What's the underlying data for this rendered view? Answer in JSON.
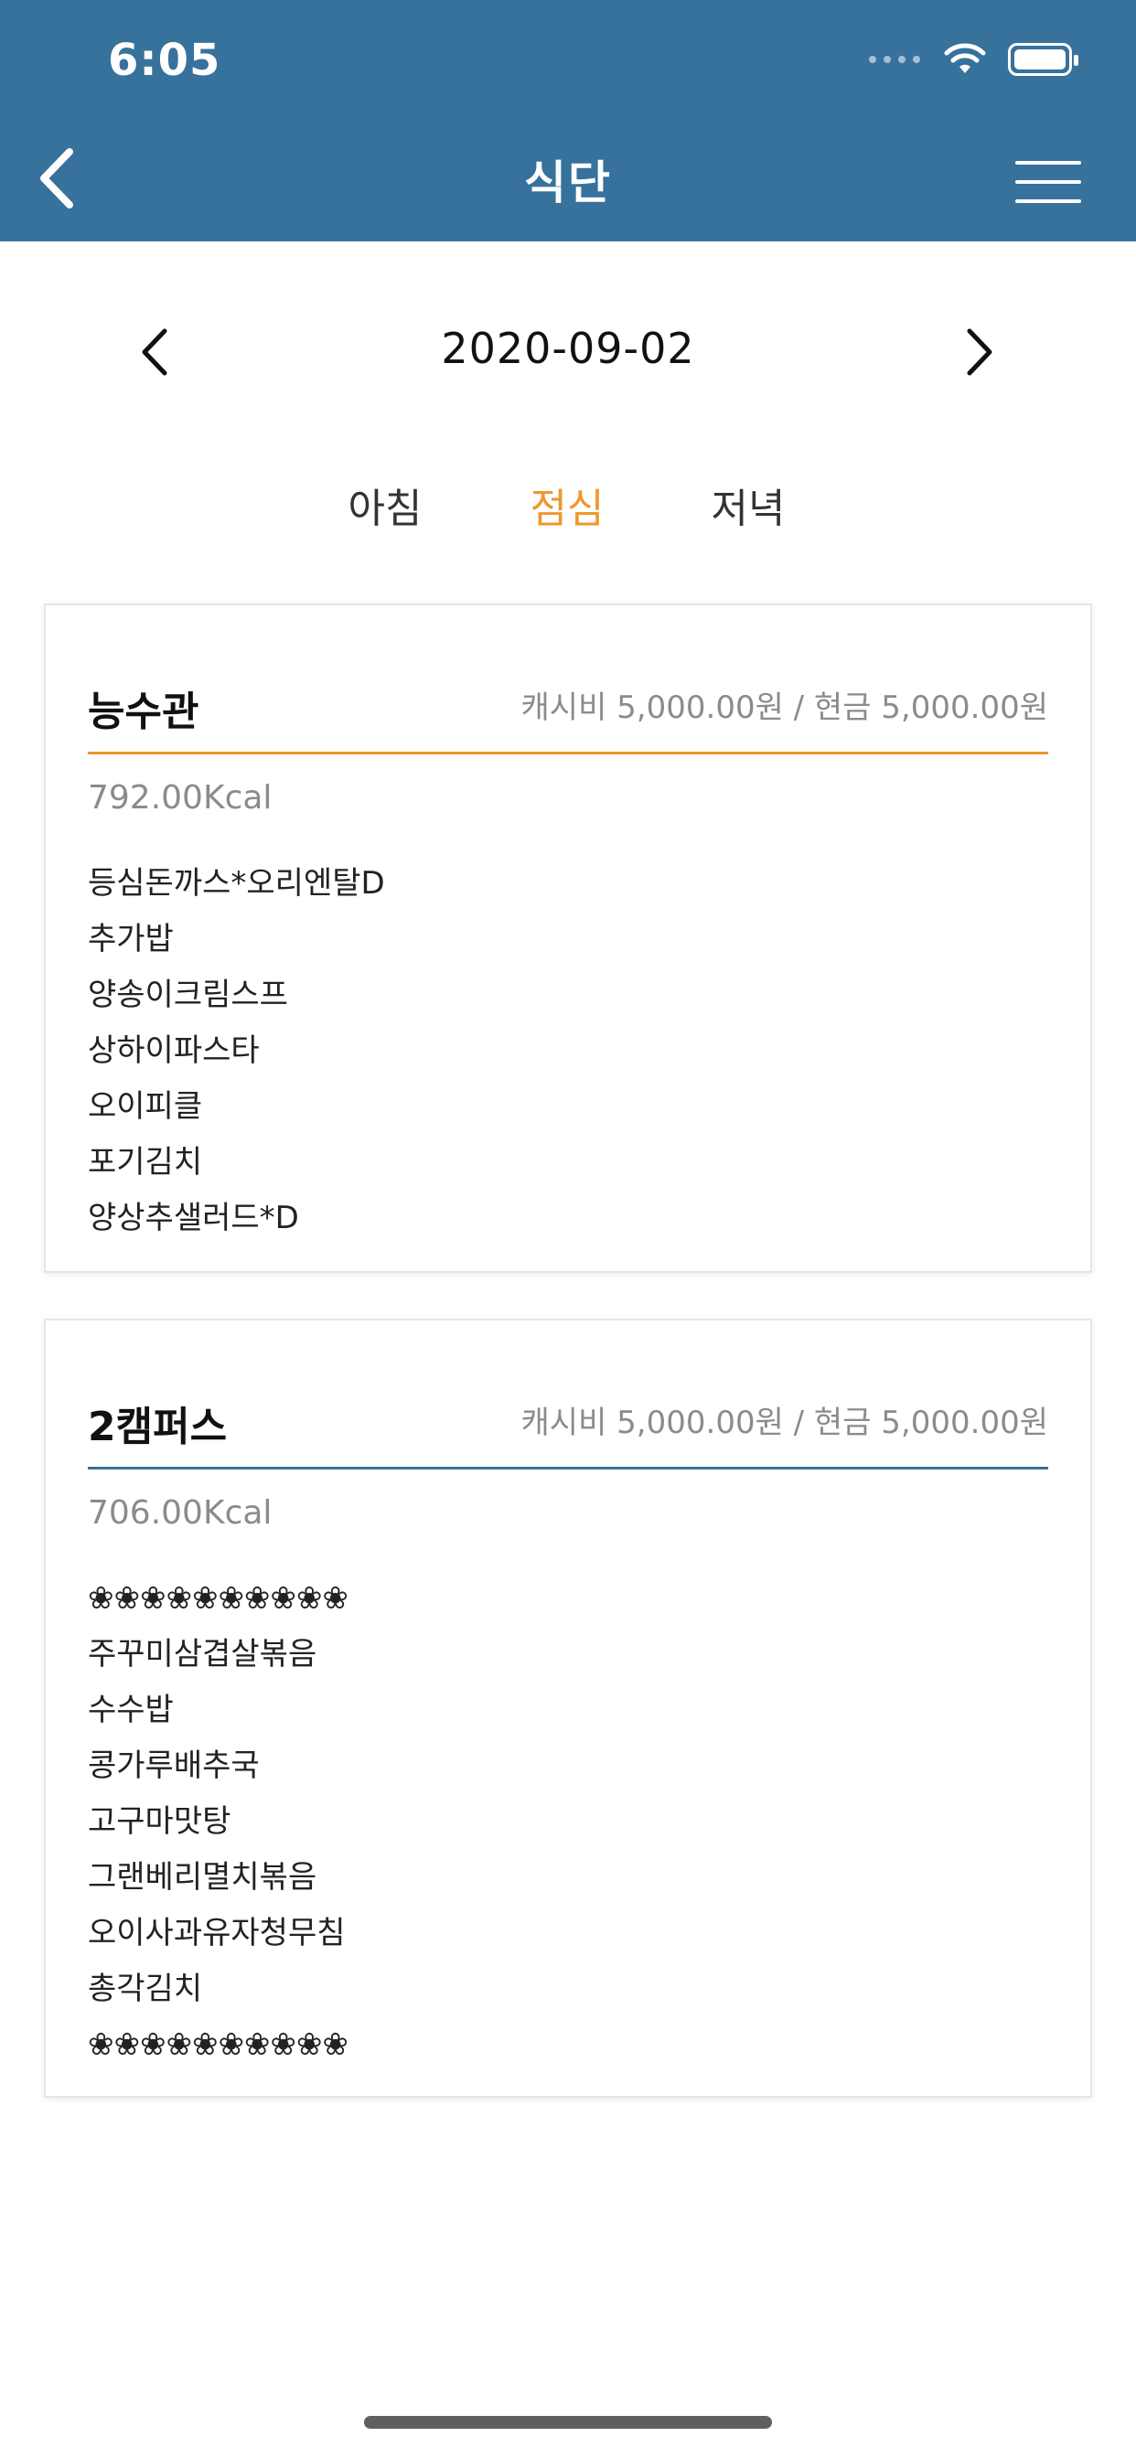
{
  "status_bar": {
    "time": "6:05"
  },
  "header": {
    "title": "식단"
  },
  "date_nav": {
    "date": "2020-09-02"
  },
  "meal_tabs": [
    {
      "label": "아침",
      "active": false
    },
    {
      "label": "점심",
      "active": true
    },
    {
      "label": "저녁",
      "active": false
    }
  ],
  "cards": [
    {
      "name": "능수관",
      "price": "캐시비 5,000.00원 / 현금 5,000.00원",
      "kcal": "792.00Kcal",
      "accent_color": "#f0962e",
      "items": [
        "등심돈까스*오리엔탈D",
        "추가밥",
        "양송이크림스프",
        "상하이파스타",
        "오이피클",
        "포기김치",
        "양상추샐러드*D"
      ]
    },
    {
      "name": "2캠퍼스",
      "price": "캐시비 5,000.00원 / 현금 5,000.00원",
      "kcal": "706.00Kcal",
      "accent_color": "#37729c",
      "items": [
        "❀❀❀❀❀❀❀❀❀❀",
        "주꾸미삼겹살볶음",
        "수수밥",
        "콩가루배추국",
        "고구마맛탕",
        "그랜베리멸치볶음",
        "오이사과유자청무침",
        "총각김치",
        "❀❀❀❀❀❀❀❀❀❀"
      ]
    }
  ],
  "colors": {
    "header_bg": "#37729c",
    "active_tab": "#f0962e"
  },
  "icons": {
    "back": "chevron-left-icon",
    "menu": "hamburger-menu-icon",
    "prev_date": "chevron-left-icon",
    "next_date": "chevron-right-icon"
  }
}
